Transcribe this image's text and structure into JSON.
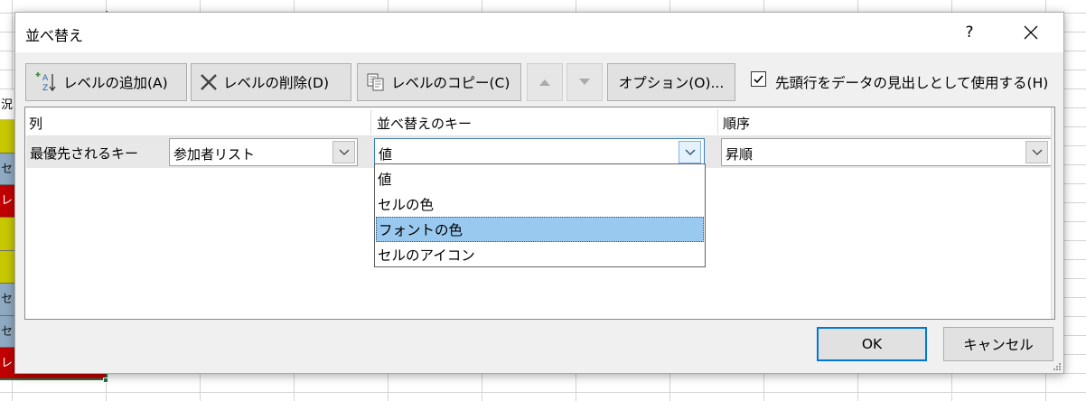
{
  "sheet": {
    "cells": [
      {
        "text": "況",
        "style": "white"
      },
      {
        "text": "",
        "style": "yellow"
      },
      {
        "text": "セ",
        "style": "blue"
      },
      {
        "text": "レ",
        "style": "red"
      },
      {
        "text": "",
        "style": "yellow"
      },
      {
        "text": "",
        "style": "yellow"
      },
      {
        "text": "セ",
        "style": "blue"
      },
      {
        "text": "セ",
        "style": "blue"
      },
      {
        "text": "レ",
        "style": "red"
      }
    ]
  },
  "dialog": {
    "title": "並べ替え",
    "help_label": "?",
    "toolbar": {
      "add_level_label": "レベルの追加(A)",
      "delete_level_label": "レベルの削除(D)",
      "copy_level_label": "レベルのコピー(C)",
      "options_label": "オプション(O)...",
      "header_checkbox_label": "先頭行をデータの見出しとして使用する(H)",
      "header_checkbox_checked": true
    },
    "grid": {
      "columns": [
        "列",
        "並べ替えのキー",
        "順序"
      ],
      "level_label": "最優先されるキー",
      "column_value": "参加者リスト",
      "sort_on_value": "値",
      "order_value": "昇順"
    },
    "dropdown": {
      "options": [
        "値",
        "セルの色",
        "フォントの色",
        "セルのアイコン"
      ],
      "highlighted_index": 2
    },
    "ok_label": "OK",
    "cancel_label": "キャンセル"
  }
}
